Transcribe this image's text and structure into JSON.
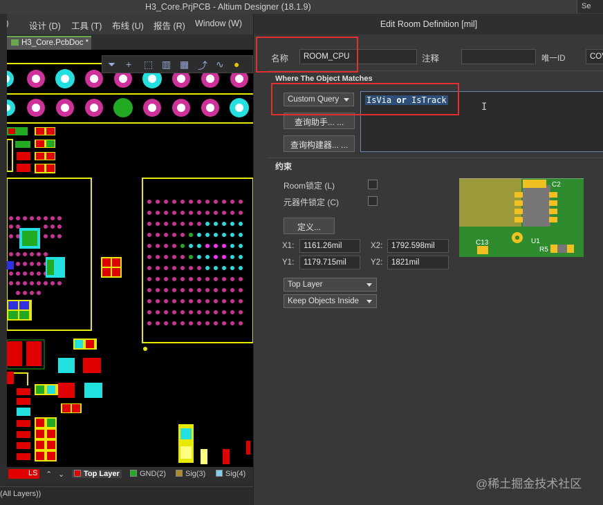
{
  "app": {
    "title": "H3_Core.PrjPCB - Altium Designer (18.1.9)",
    "search_label": "Se"
  },
  "menu": [
    {
      "label": "P)"
    },
    {
      "label": "设计 (D)"
    },
    {
      "label": "工具 (T)"
    },
    {
      "label": "布线 (U)"
    },
    {
      "label": "报告 (R)"
    },
    {
      "label": "Window (W)"
    }
  ],
  "doc_tab": {
    "label": "H3_Core.PcbDoc *"
  },
  "layers": {
    "ls_label": "LS",
    "items": [
      {
        "label": "Top Layer",
        "color": "#e00000"
      },
      {
        "label": "GND(2)",
        "color": "#22aa22"
      },
      {
        "label": "Sig(3)",
        "color": "#b08a20"
      },
      {
        "label": "Sig(4)",
        "color": "#7fd0ee"
      }
    ]
  },
  "status": {
    "text": "(All Layers))"
  },
  "dialog": {
    "title": "Edit Room Definition [mil]",
    "name_label": "名称",
    "name_value": "ROOM_CPU",
    "comment_label": "注释",
    "comment_value": "",
    "uid_label": "唯一ID",
    "uid_value": "COV",
    "where_section": "Where The Object Matches",
    "query_type": "Custom Query",
    "query_helper_button": "查询助手... ...",
    "query_builder_button": "查询构建器... ...",
    "query_text": {
      "part1": "IsVia",
      "op": "or",
      "part2": "IsTrack"
    },
    "constraints_section": "约束",
    "room_locked_label": "Room锁定 (L)",
    "room_locked": false,
    "components_locked_label": "元器件锁定 (C)",
    "components_locked": false,
    "define_button": "定义...",
    "x1_label": "X1:",
    "x1_value": "1161.26mil",
    "x2_label": "X2:",
    "x2_value": "1792.598mil",
    "y1_label": "Y1:",
    "y1_value": "1179.715mil",
    "y2_label": "Y2:",
    "y2_value": "1821mil",
    "layer_option": "Top Layer",
    "keep_option": "Keep Objects Inside",
    "preview_labels": {
      "c2": "C2",
      "u1": "U1",
      "c13": "C13",
      "r5": "R5"
    }
  },
  "watermark": "@稀土掘金技术社区",
  "colors": {
    "highlight_red": "#e23030",
    "pad_cyan": "#22e0e0",
    "pad_magenta": "#d0309a",
    "outline_yellow": "#e8e800"
  }
}
